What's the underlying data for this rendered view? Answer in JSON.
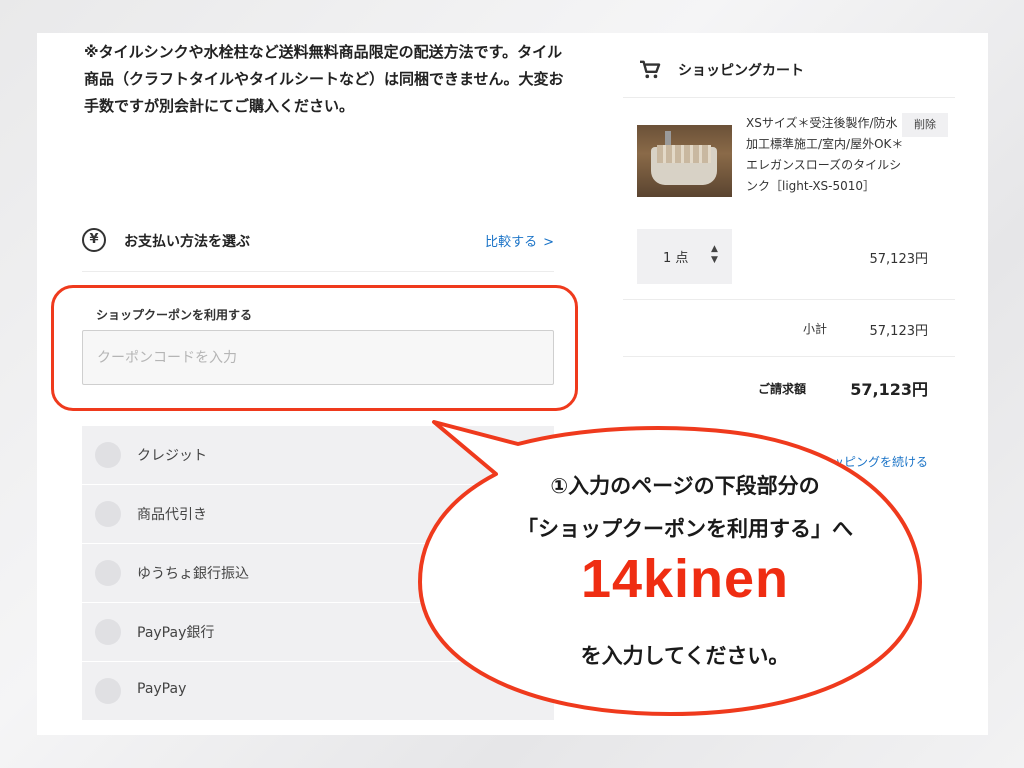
{
  "notice": {
    "text": "※タイルシンクや水栓柱など送料無料商品限定の配送方法です。タイル商品（クラフトタイルやタイルシートなど）は同梱できません。大変お手数ですが別会計にてご購入ください。"
  },
  "payment": {
    "title": "お支払い方法を選ぶ",
    "compare_label": "比較する",
    "yen_symbol": "¥",
    "coupon": {
      "label": "ショップクーポンを利用する",
      "placeholder": "クーポンコードを入力",
      "value": ""
    },
    "options": [
      {
        "label": "クレジット"
      },
      {
        "label": "商品代引き"
      },
      {
        "label": "ゆうちょ銀行振込"
      },
      {
        "label": "PayPay銀行"
      },
      {
        "label": "PayPay"
      }
    ]
  },
  "cart": {
    "title": "ショッピングカート",
    "item": {
      "name": "XSサイズ＊受注後製作/防水加工標準施工/室内/屋外OK＊エレガンスローズのタイルシンク［light-XS-5010］",
      "delete_label": "削除",
      "quantity": "1 点",
      "price": "57,123円"
    },
    "subtotal_label": "小計",
    "subtotal": "57,123円",
    "total_label": "ご請求額",
    "total": "57,123円",
    "continue_label": "く ショッピングを続ける"
  },
  "bubble": {
    "line1": "①入力のページの下段部分の",
    "line2": "「ショップクーポンを利用する」へ",
    "code": "14kinen",
    "line3": "を入力してください。"
  },
  "colors": {
    "accent_red": "#ef3a1d",
    "link_blue": "#1a73c7"
  }
}
